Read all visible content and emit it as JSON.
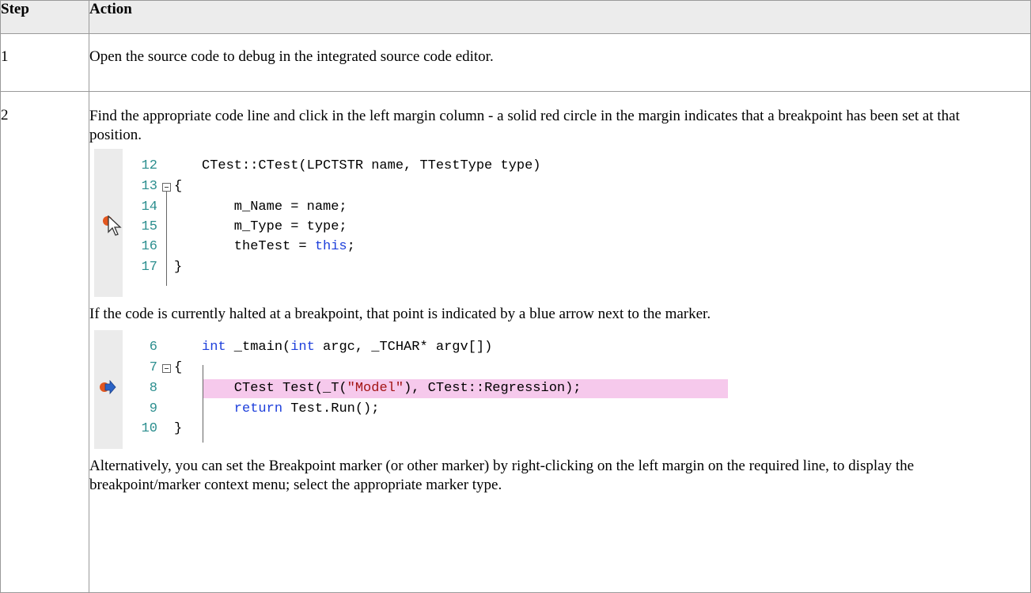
{
  "table": {
    "header_step": "Step",
    "header_action": "Action",
    "rows": [
      {
        "step": "1",
        "text": "Open the source code to debug in the integrated source code editor."
      },
      {
        "step": "2",
        "text1": "Find the appropriate code line and click in the left margin column - a solid red circle in the margin indicates that a breakpoint has been set at that position.",
        "text2": "If the code is currently halted at a breakpoint, that point is indicated by a blue arrow next to the marker.",
        "text3": "Alternatively, you can set the Breakpoint marker (or other marker) by right-clicking on the left margin on the required line, to display the breakpoint/marker context menu; select the appropriate marker type."
      }
    ]
  },
  "code1": {
    "lines": [
      {
        "num": "12",
        "code": "CTest::CTest(LPCTSTR name, TTestType type)"
      },
      {
        "num": "13",
        "code": "{"
      },
      {
        "num": "14",
        "code": "    m_Name = name;"
      },
      {
        "num": "15",
        "code": "    m_Type = type;"
      },
      {
        "num": "16",
        "code": "    theTest = ",
        "kw": "this",
        "tail": ";"
      },
      {
        "num": "17",
        "code": "}"
      }
    ]
  },
  "code2": {
    "lines": [
      {
        "num": "6",
        "kw1": "int",
        "mid": " _tmain(",
        "kw2": "int",
        "tail": " argc, _TCHAR* argv[])"
      },
      {
        "num": "7",
        "code": "{"
      },
      {
        "num": "8",
        "pre": "    CTest Test(_T(",
        "str": "\"Model\"",
        "post": "), CTest::Regression);"
      },
      {
        "num": "9",
        "kw": "    return",
        "tail": " Test.Run();"
      },
      {
        "num": "10",
        "code": "}"
      }
    ]
  },
  "colors": {
    "breakpoint": "#e2561e",
    "arrow": "#2b63c6",
    "highlight": "#f6c9ec",
    "line_number": "#2b8e8e",
    "keyword": "#1d3fdb",
    "string": "#a31515"
  },
  "icons": [
    "breakpoint-icon",
    "mouse-pointer-icon",
    "current-line-arrow-icon",
    "collapse-icon"
  ]
}
